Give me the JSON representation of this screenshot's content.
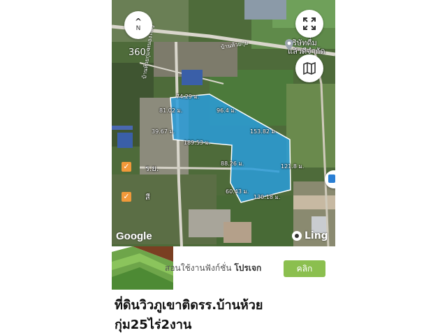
{
  "map": {
    "compass_arrow": "^",
    "compass_letter": "N",
    "label_360": "360°",
    "road_top": "บ้านห้วยกุ่ม",
    "road_left": "บ้านห้วยกุ่ม-หนองใหญ่",
    "poi_company_line1": "บริษัทดื่ม",
    "poi_company_line2": "แล้วดีจำกัด",
    "poi_label_1": "ร.ย.",
    "poi_label_2": "สี",
    "attribution_google": "Google",
    "attribution_ling": "Ling",
    "icons": [
      "compass-icon",
      "fullscreen-icon",
      "map-layer-icon",
      "location-pin-icon",
      "checkbox-icon",
      "owl-icon"
    ],
    "measurements": [
      "74.29 ม.",
      "96.4 ม.",
      "81.02 ม.",
      "153.82 ม.",
      "39.67 ม.",
      "189.53 ม.",
      "88.26 ม.",
      "121.8 ม.",
      "60.43 ม.",
      "130.18 ม."
    ],
    "plot_color": "#2a9cdb"
  },
  "ad": {
    "text_prefix": "สอนใช้งานฟังก์ชั่น",
    "text_bold": "โปรเจก",
    "button_label": "คลิก",
    "button_color": "#8bbf4f"
  },
  "listing": {
    "title": "ที่ดินวิวภูเขาติดรร.บ้านห้วยกุ่ม25ไร่2งาน"
  }
}
